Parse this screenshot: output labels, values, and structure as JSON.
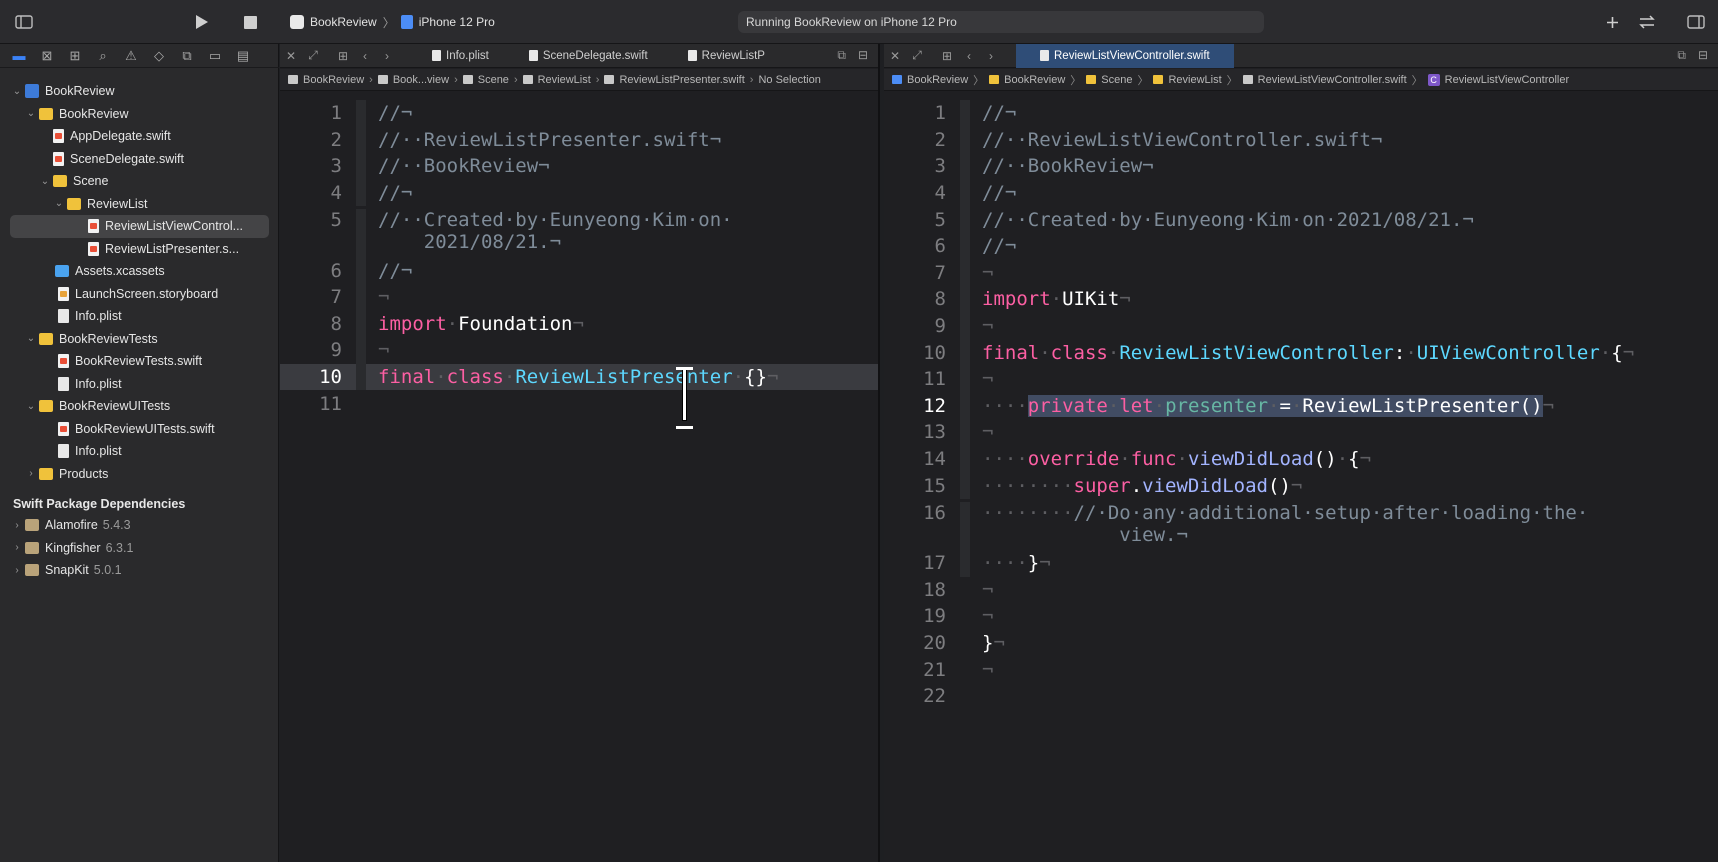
{
  "toolbar": {
    "scheme_app": "BookReview",
    "scheme_device": "iPhone 12 Pro",
    "activity": "Running BookReview on iPhone 12 Pro"
  },
  "navigator": {
    "tree": [
      {
        "label": "BookReview",
        "icon": "project-icon",
        "depth": 0,
        "disclosure": "open"
      },
      {
        "label": "BookReview",
        "icon": "folder-icon",
        "depth": 1,
        "disclosure": "open"
      },
      {
        "label": "AppDelegate.swift",
        "icon": "swift-file-icon",
        "depth": 2
      },
      {
        "label": "SceneDelegate.swift",
        "icon": "swift-file-icon",
        "depth": 2
      },
      {
        "label": "Scene",
        "icon": "folder-icon",
        "depth": 2,
        "disclosure": "open"
      },
      {
        "label": "ReviewList",
        "icon": "folder-icon",
        "depth": 3,
        "disclosure": "open"
      },
      {
        "label": "ReviewListViewControl...",
        "icon": "swift-file-icon",
        "depth": 4,
        "selected": true
      },
      {
        "label": "ReviewListPresenter.s...",
        "icon": "swift-file-icon",
        "depth": 4
      },
      {
        "label": "Assets.xcassets",
        "icon": "assets-icon",
        "depth": 2
      },
      {
        "label": "LaunchScreen.storyboard",
        "icon": "storyboard-icon",
        "depth": 2
      },
      {
        "label": "Info.plist",
        "icon": "plist-icon",
        "depth": 2
      },
      {
        "label": "BookReviewTests",
        "icon": "folder-icon",
        "depth": 1,
        "disclosure": "open"
      },
      {
        "label": "BookReviewTests.swift",
        "icon": "swift-file-icon",
        "depth": 2
      },
      {
        "label": "Info.plist",
        "icon": "plist-icon",
        "depth": 2
      },
      {
        "label": "BookReviewUITests",
        "icon": "folder-icon",
        "depth": 1,
        "disclosure": "open"
      },
      {
        "label": "BookReviewUITests.swift",
        "icon": "swift-file-icon",
        "depth": 2
      },
      {
        "label": "Info.plist",
        "icon": "plist-icon",
        "depth": 2
      },
      {
        "label": "Products",
        "icon": "folder-icon",
        "depth": 1,
        "disclosure": "closed"
      }
    ],
    "packages_title": "Swift Package Dependencies",
    "packages": [
      {
        "name": "Alamofire",
        "version": "5.4.3"
      },
      {
        "name": "Kingfisher",
        "version": "6.3.1"
      },
      {
        "name": "SnapKit",
        "version": "5.0.1"
      }
    ]
  },
  "left_editor": {
    "tabs": [
      "Info.plist",
      "SceneDelegate.swift",
      "ReviewListP"
    ],
    "jump": [
      "BookReview",
      "Book...view",
      "Scene",
      "ReviewList",
      "ReviewListPresenter.swift",
      "No Selection"
    ],
    "lines": [
      "1",
      "2",
      "3",
      "4",
      "5",
      "6",
      "7",
      "8",
      "9",
      "10",
      "11"
    ]
  },
  "right_editor": {
    "tab": "ReviewListViewController.swift",
    "jump": [
      "BookReview",
      "BookReview",
      "Scene",
      "ReviewList",
      "ReviewListViewController.swift",
      "ReviewListViewController"
    ],
    "lines": [
      "1",
      "2",
      "3",
      "4",
      "5",
      "6",
      "7",
      "8",
      "9",
      "10",
      "11",
      "12",
      "13",
      "14",
      "15",
      "16",
      "17",
      "18",
      "19",
      "20",
      "21",
      "22"
    ]
  },
  "colors": {
    "keyword": "#fc5fa3",
    "type": "#5dd8ff",
    "identifier": "#67b7a4",
    "comment": "#7f8c99",
    "accent": "#2f4d77"
  }
}
